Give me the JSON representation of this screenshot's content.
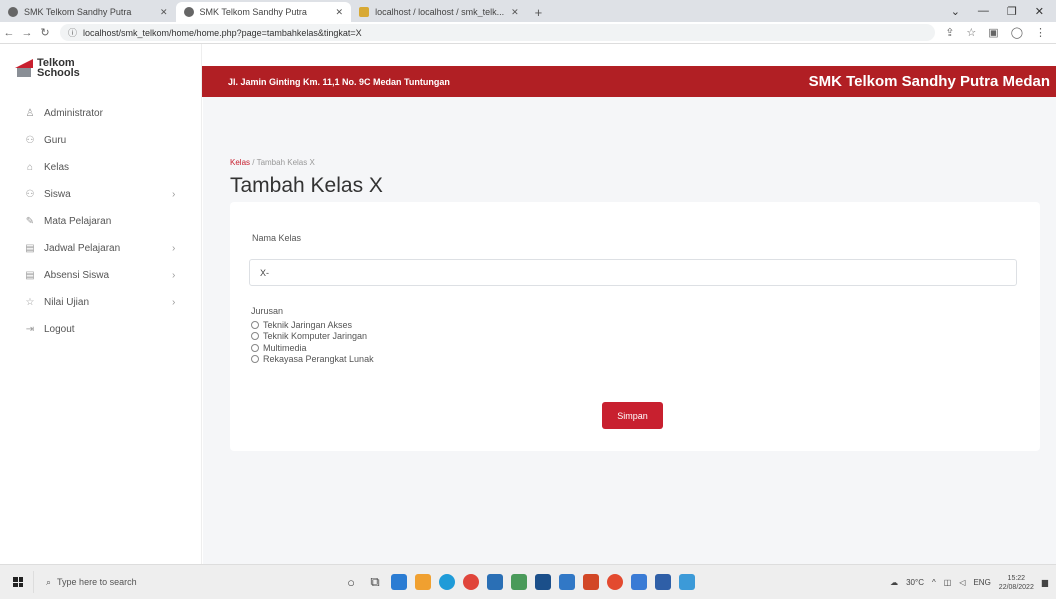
{
  "browser": {
    "tabs": [
      {
        "title": "SMK Telkom Sandhy Putra",
        "active": false
      },
      {
        "title": "SMK Telkom Sandhy Putra",
        "active": true
      },
      {
        "title": "localhost / localhost / smk_telk...",
        "active": false
      }
    ],
    "url": "localhost/smk_telkom/home/home.php?page=tambahkelas&tingkat=X"
  },
  "sidebar": {
    "logo_top": "Telkom",
    "logo_bottom": "Schools",
    "items": [
      {
        "label": "Administrator",
        "icon": "user-icon"
      },
      {
        "label": "Guru",
        "icon": "users-icon"
      },
      {
        "label": "Kelas",
        "icon": "home-icon"
      },
      {
        "label": "Siswa",
        "icon": "users-icon",
        "chevron": true
      },
      {
        "label": "Mata Pelajaran",
        "icon": "book-icon"
      },
      {
        "label": "Jadwal Pelajaran",
        "icon": "table-icon",
        "chevron": true
      },
      {
        "label": "Absensi Siswa",
        "icon": "table-icon",
        "chevron": true
      },
      {
        "label": "Nilai Ujian",
        "icon": "star-icon",
        "chevron": true
      },
      {
        "label": "Logout",
        "icon": "logout-icon"
      }
    ]
  },
  "header": {
    "address": "Jl. Jamin Ginting Km. 11,1 No. 9C Medan Tuntungan",
    "school_name": "SMK Telkom Sandhy Putra Medan",
    "color": "#b11f24"
  },
  "main": {
    "breadcrumb": [
      "Kelas",
      "Tambah Kelas X"
    ],
    "title": "Tambah Kelas X",
    "form": {
      "nama_label": "Nama Kelas",
      "nama_value": "X-",
      "jurusan_label": "Jurusan",
      "jurusan_options": [
        "Teknik Jaringan Akses",
        "Teknik Komputer Jaringan",
        "Multimedia",
        "Rekayasa Perangkat Lunak"
      ],
      "submit_label": "Simpan"
    }
  },
  "taskbar": {
    "search_placeholder": "Type here to search",
    "temperature": "30°C",
    "language": "ENG",
    "time": "15:22",
    "date": "22/08/2022"
  }
}
